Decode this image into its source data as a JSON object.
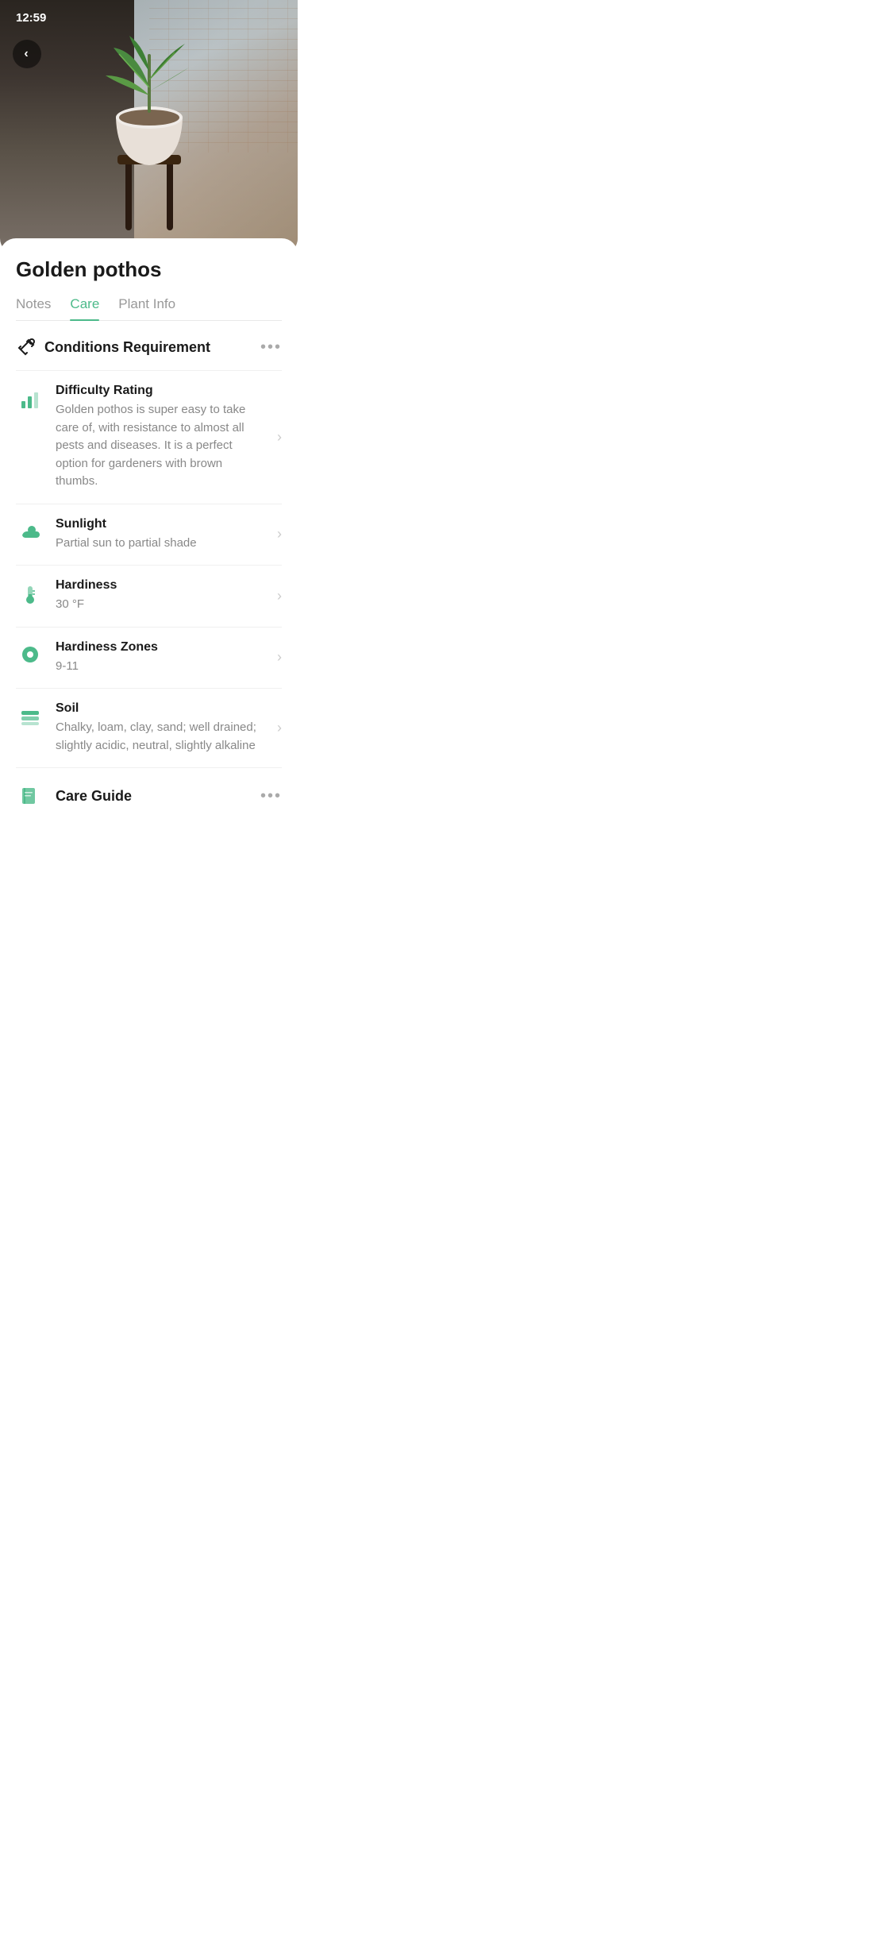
{
  "statusBar": {
    "time": "12:59",
    "wifi": "wifi",
    "battery": "battery"
  },
  "hero": {
    "alt": "Golden pothos plant in pot on windowsill"
  },
  "backButton": {
    "label": "‹"
  },
  "plant": {
    "name": "Golden pothos"
  },
  "tabs": [
    {
      "id": "notes",
      "label": "Notes",
      "active": false
    },
    {
      "id": "care",
      "label": "Care",
      "active": true
    },
    {
      "id": "plant-info",
      "label": "Plant Info",
      "active": false
    }
  ],
  "section": {
    "title": "Conditions Requirement",
    "moreLabel": "•••"
  },
  "items": [
    {
      "id": "difficulty",
      "title": "Difficulty Rating",
      "desc": "Golden pothos is super easy to take care of, with resistance to almost all pests and diseases. It is a perfect option for gardeners with brown thumbs.",
      "icon": "chart-bar-icon",
      "hasChevron": true
    },
    {
      "id": "sunlight",
      "title": "Sunlight",
      "desc": "Partial sun to partial shade",
      "icon": "cloud-sun-icon",
      "hasChevron": true
    },
    {
      "id": "hardiness",
      "title": "Hardiness",
      "desc": "30 °F",
      "icon": "thermometer-icon",
      "hasChevron": true
    },
    {
      "id": "hardiness-zones",
      "title": "Hardiness Zones",
      "desc": "9-11",
      "icon": "location-icon",
      "hasChevron": true
    },
    {
      "id": "soil",
      "title": "Soil",
      "desc": "Chalky, loam, clay, sand; well drained; slightly acidic, neutral, slightly alkaline",
      "icon": "soil-icon",
      "hasChevron": true
    }
  ],
  "bottomSection": {
    "title": "Care Guide",
    "moreLabel": "•••",
    "icon": "book-icon"
  }
}
